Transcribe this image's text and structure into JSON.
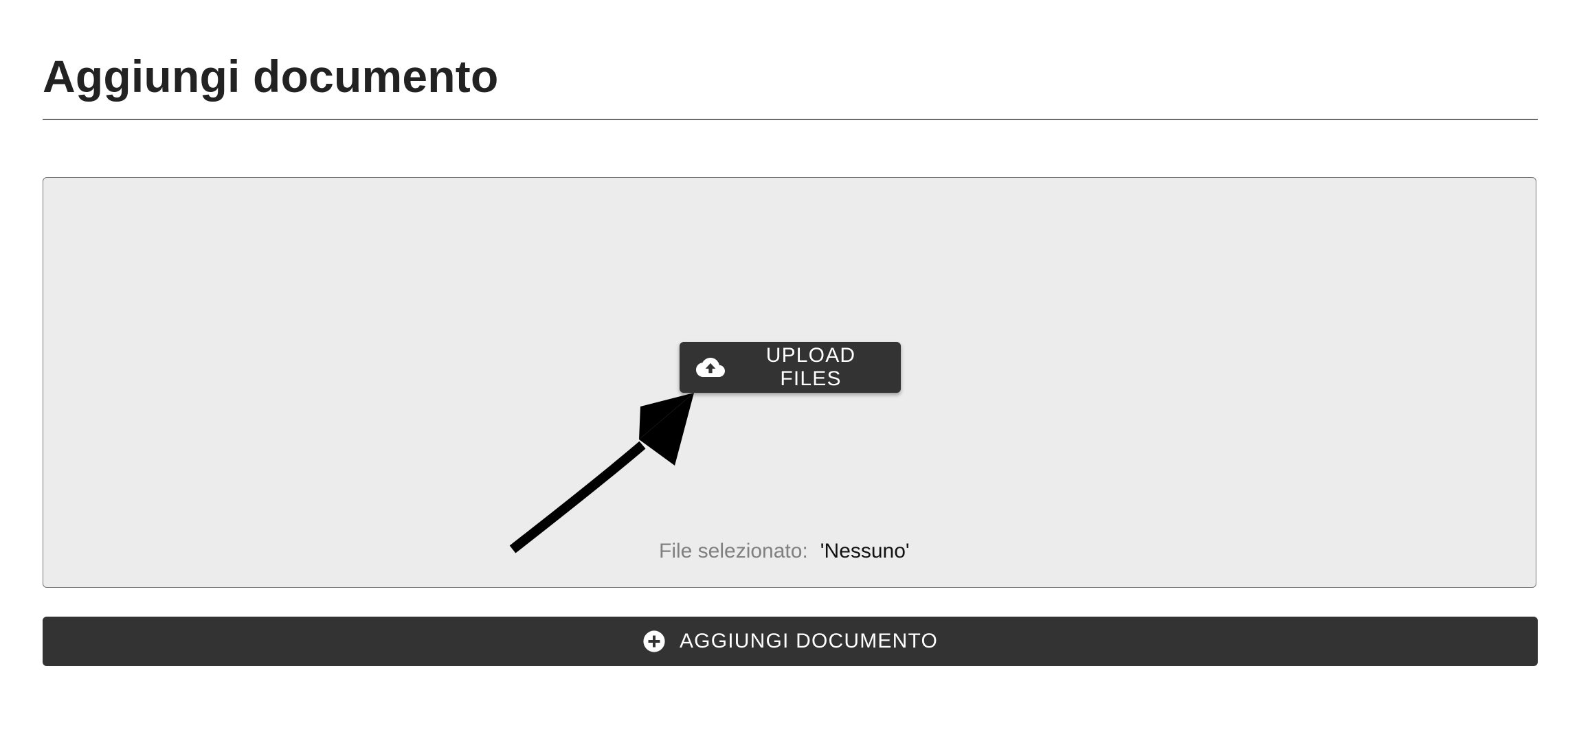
{
  "page": {
    "title": "Aggiungi documento"
  },
  "upload": {
    "button_label": "UPLOAD FILES",
    "button_icon": "cloud-upload-icon",
    "selected_label": "File selezionato:",
    "selected_value": "'Nessuno'"
  },
  "annotation": {
    "icon": "arrow-pointer-icon"
  },
  "actions": {
    "add_label": "AGGIUNGI DOCUMENTO",
    "add_icon": "plus-circle-icon"
  },
  "colors": {
    "button_bg": "#333333",
    "drop_zone_bg": "#ececec",
    "label_gray": "#808080"
  }
}
